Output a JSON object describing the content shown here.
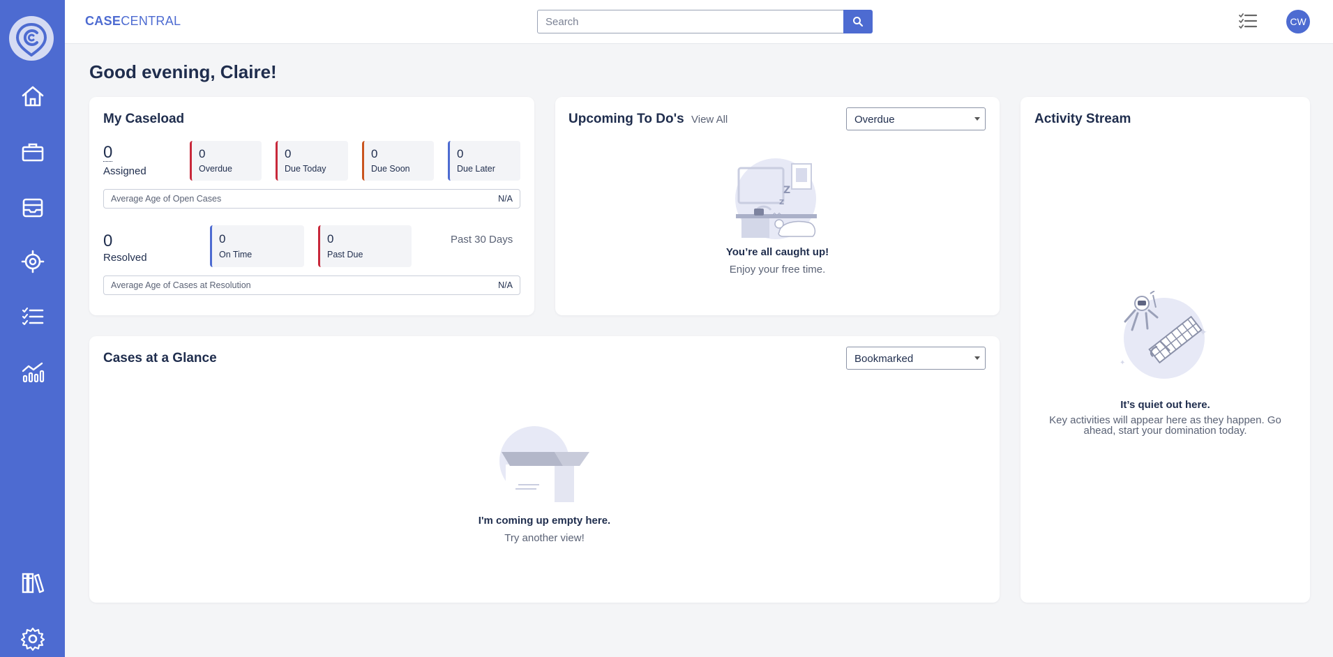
{
  "brand": {
    "part1": "CASE",
    "part2": "CENTRAL"
  },
  "search": {
    "placeholder": "Search"
  },
  "user": {
    "initials": "CW"
  },
  "greeting": "Good evening, Claire!",
  "caseload": {
    "title": "My Caseload",
    "assigned": {
      "value": "0",
      "label": "Assigned"
    },
    "status_boxes": [
      {
        "value": "0",
        "label": "Overdue"
      },
      {
        "value": "0",
        "label": "Due Today"
      },
      {
        "value": "0",
        "label": "Due Soon"
      },
      {
        "value": "0",
        "label": "Due Later"
      }
    ],
    "avg_open": {
      "label": "Average Age of Open Cases",
      "value": "N/A"
    },
    "resolved": {
      "value": "0",
      "label": "Resolved"
    },
    "resolved_boxes": [
      {
        "value": "0",
        "label": "On Time"
      },
      {
        "value": "0",
        "label": "Past Due"
      }
    ],
    "period": "Past 30 Days",
    "avg_resolved": {
      "label": "Average Age of Cases at Resolution",
      "value": "N/A"
    }
  },
  "todos": {
    "title": "Upcoming To Do's",
    "view_all": "View All",
    "filter": "Overdue",
    "empty_title": "You’re all caught up!",
    "empty_sub": "Enjoy your free time."
  },
  "activity": {
    "title": "Activity Stream",
    "empty_title": "It’s quiet out here.",
    "empty_sub": "Key activities will appear here as they happen. Go ahead, start your domination today."
  },
  "glance": {
    "title": "Cases at a Glance",
    "filter": "Bookmarked",
    "empty_title": "I'm coming up empty here.",
    "empty_sub": "Try another view!"
  },
  "colors": {
    "sidebar": "#4d6bd1",
    "red_accent": "#c8283a",
    "orange_accent": "#c9541e",
    "blue_accent": "#4d6bd1"
  },
  "icons": {
    "nav": [
      "home-icon",
      "briefcase-icon",
      "inbox-icon",
      "target-icon",
      "checklist-icon",
      "analytics-icon",
      "library-icon",
      "settings-icon"
    ]
  }
}
